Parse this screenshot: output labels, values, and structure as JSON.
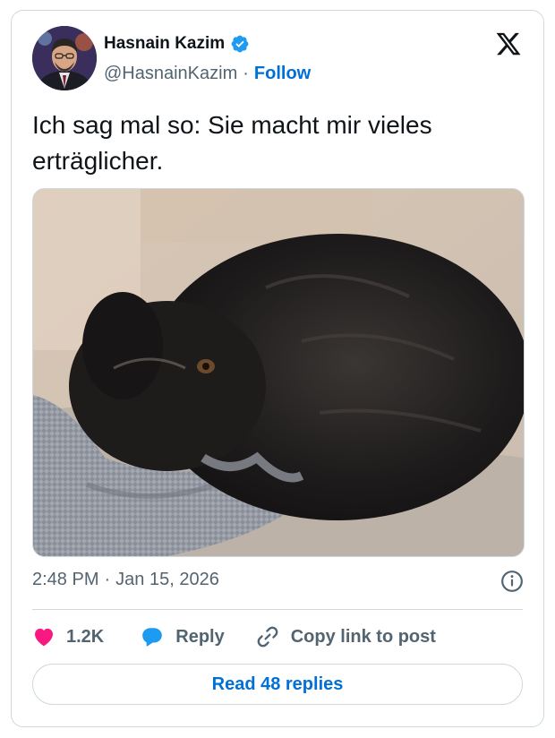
{
  "author": {
    "name": "Hasnain Kazim",
    "handle": "@HasnainKazim",
    "follow_label": "Follow",
    "separator": "·",
    "verified": true
  },
  "icons": {
    "avatar": "author-photo",
    "verified": "verified-badge-icon",
    "logo": "x-logo-icon",
    "info": "info-icon",
    "like": "heart-icon",
    "reply": "speech-bubble-icon",
    "copy": "link-icon"
  },
  "tweet": {
    "text": "Ich sag mal so: Sie macht mir vieles erträglicher.",
    "media_description": "dog-photo",
    "time": "2:48 PM",
    "separator": "·",
    "date": "Jan 15, 2026"
  },
  "actions": {
    "likes": "1.2K",
    "reply_label": "Reply",
    "copy_label": "Copy link to post"
  },
  "read_replies_label": "Read 48 replies",
  "colors": {
    "accent": "#006fd6",
    "verified": "#1d9bf0",
    "like": "#f91880",
    "text": "#0f1419",
    "muted": "#536471",
    "border": "#cfd9de"
  }
}
